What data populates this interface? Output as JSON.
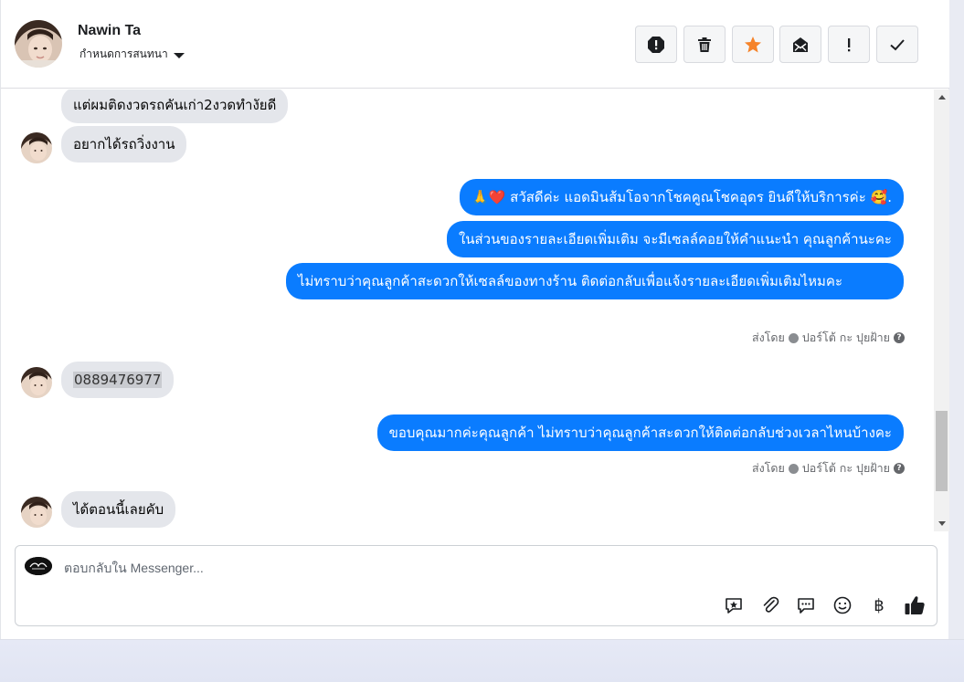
{
  "contact": {
    "name": "Nawin Ta",
    "assign_label": "กำหนดการสนทนา"
  },
  "toolbar": {
    "buttons": [
      {
        "name": "report-button",
        "icon": "alert-octagon-icon"
      },
      {
        "name": "delete-button",
        "icon": "trash-icon"
      },
      {
        "name": "star-button",
        "icon": "star-icon"
      },
      {
        "name": "mark-unread-button",
        "icon": "envelope-icon"
      },
      {
        "name": "important-button",
        "icon": "exclamation-icon"
      },
      {
        "name": "done-button",
        "icon": "check-icon"
      }
    ],
    "star_color": "#f5832a"
  },
  "messages": {
    "m1": "แต่ผมติดงวดรถคันเก่า2งวดทำงัยดี",
    "m2": "อยากได้รถวิ่งงาน",
    "m3_text": "สวัสดีค่ะ แอดมินส้มโอจากโชคคูณโชคอุดร ยินดีให้บริการค่ะ",
    "m3_emoji_lead": "🙏❤️",
    "m3_emoji_tail": "🥰.",
    "m4": "ในส่วนของรายละเอียดเพิ่มเติม จะมีเซลล์คอยให้คำแนะนำ คุณลูกค้านะคะ",
    "m5": "ไม่ทราบว่าคุณลูกค้าสะดวกให้เซลล์ของทางร้าน ติดต่อกลับเพื่อแจ้งรายละเอียดเพิ่มเติมไหมคะ",
    "sent_by_1_prefix": "ส่งโดย",
    "sent_by_1_name": "ปอร์โต้ กะ ปุยฝ้าย",
    "m6": "0889476977",
    "m7": "ขอบคุณมากค่ะคุณลูกค้า ไม่ทราบว่าคุณลูกค้าสะดวกให้ติดต่อกลับช่วงเวลาไหนบ้างคะ",
    "sent_by_2_prefix": "ส่งโดย",
    "sent_by_2_name": "ปอร์โต้ กะ ปุยฝ้าย",
    "m8": "ได้ตอนนี้เลยคับ"
  },
  "composer": {
    "placeholder": "ตอบกลับใน Messenger...",
    "icons": [
      "saved-reply-icon",
      "attachment-icon",
      "chat-bubble-icon",
      "emoji-icon",
      "baht-icon",
      "thumbs-up-icon"
    ],
    "baht_symbol": "฿"
  },
  "colors": {
    "outgoing_bubble": "#0a7cff",
    "incoming_bubble": "#e4e6eb"
  }
}
